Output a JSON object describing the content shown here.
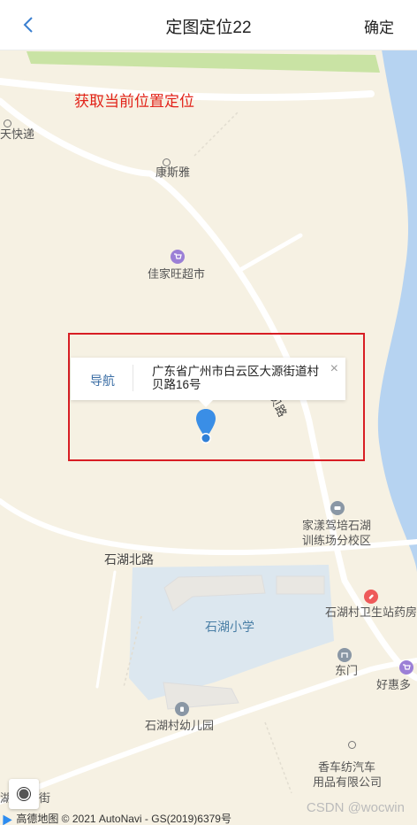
{
  "header": {
    "title": "定图定位22",
    "confirm_label": "确定",
    "back_icon": "chevron-left-icon"
  },
  "map": {
    "locate_link": "获取当前位置定位",
    "popup": {
      "nav_label": "导航",
      "address": "广东省广州市白云区大源街道村贝路16号",
      "close_glyph": "×"
    },
    "pois": {
      "express": "天快递",
      "kangsiya": "康斯雅",
      "jiajiawang": "佳家旺超市",
      "jiaxiang": "家漾驾培石湖",
      "jiaxiang_line2": "训练场分校区",
      "clinic": "石湖村卫生站药房",
      "school": "石湖小学",
      "east_gate": "东门",
      "haohui": "好惠多",
      "kindergarten": "石湖村幼儿园",
      "xiangche": "香车纺汽车",
      "xiangche_line2": "用品有限公司",
      "hu": "湖",
      "jie": "街"
    },
    "roads": {
      "shihu_north": "石湖北路",
      "cunbei": "贝路"
    },
    "attribution": "高德地图 © 2021 AutoNavi - GS(2019)6379号",
    "watermark": "CSDN @wocwin",
    "colors": {
      "accent_red": "#e2231a",
      "pin_blue": "#2f7fd6",
      "water": "#b6d3f1",
      "green": "#c9e3a4",
      "school_area": "#dce7ef"
    }
  }
}
